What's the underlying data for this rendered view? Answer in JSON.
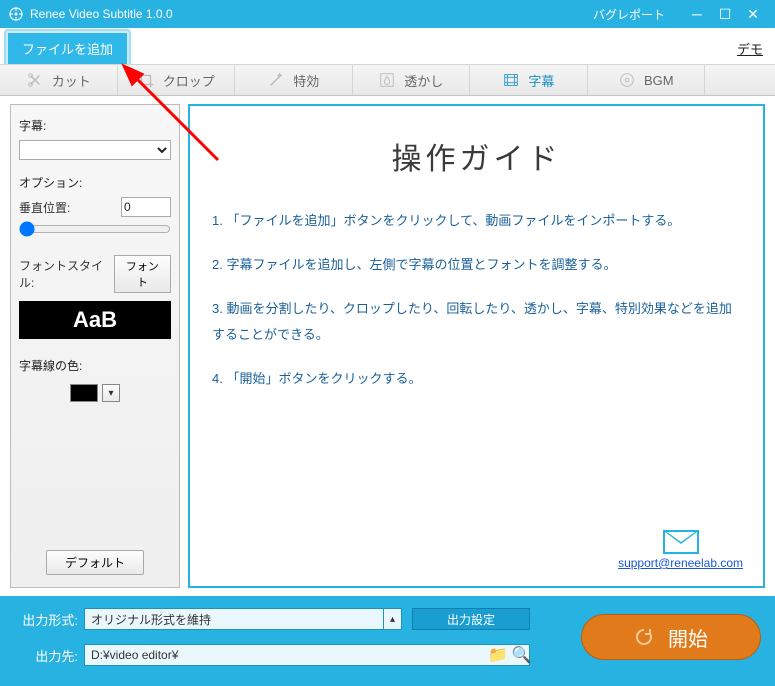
{
  "titlebar": {
    "title": "Renee Video Subtitle 1.0.0",
    "bugreport": "バグレポート"
  },
  "topbar": {
    "add_file": "ファイルを追加",
    "demo": "デモ"
  },
  "tabs": {
    "cut": "カット",
    "crop": "クロップ",
    "effect": "特効",
    "watermark": "透かし",
    "subtitle": "字幕",
    "bgm": "BGM"
  },
  "side": {
    "subtitle_label": "字幕:",
    "subtitle_value": "",
    "option_label": "オプション:",
    "vpos_label": "垂直位置:",
    "vpos_value": "0",
    "fontstyle_label": "フォントスタイル:",
    "font_btn": "フォント",
    "font_preview": "AaB",
    "linecolor_label": "字幕線の色:",
    "linecolor_value": "#000000",
    "default_btn": "デフォルト"
  },
  "guide": {
    "title": "操作ガイド",
    "items": [
      "1. 「ファイルを追加」ボタンをクリックして、動画ファイルをインポートする。",
      "2. 字幕ファイルを追加し、左側で字幕の位置とフォントを調整する。",
      "3. 動画を分割したり、クロップしたり、回転したり、透かし、字幕、特別効果などを追加することができる。",
      "4. 「開始」ボタンをクリックする。"
    ],
    "support_email": "support@reneelab.com"
  },
  "bottom": {
    "format_label": "出力形式:",
    "format_value": "オリジナル形式を維持",
    "settings_btn": "出力設定",
    "dest_label": "出力先:",
    "dest_value": "D:¥video editor¥",
    "start_btn": "開始"
  }
}
